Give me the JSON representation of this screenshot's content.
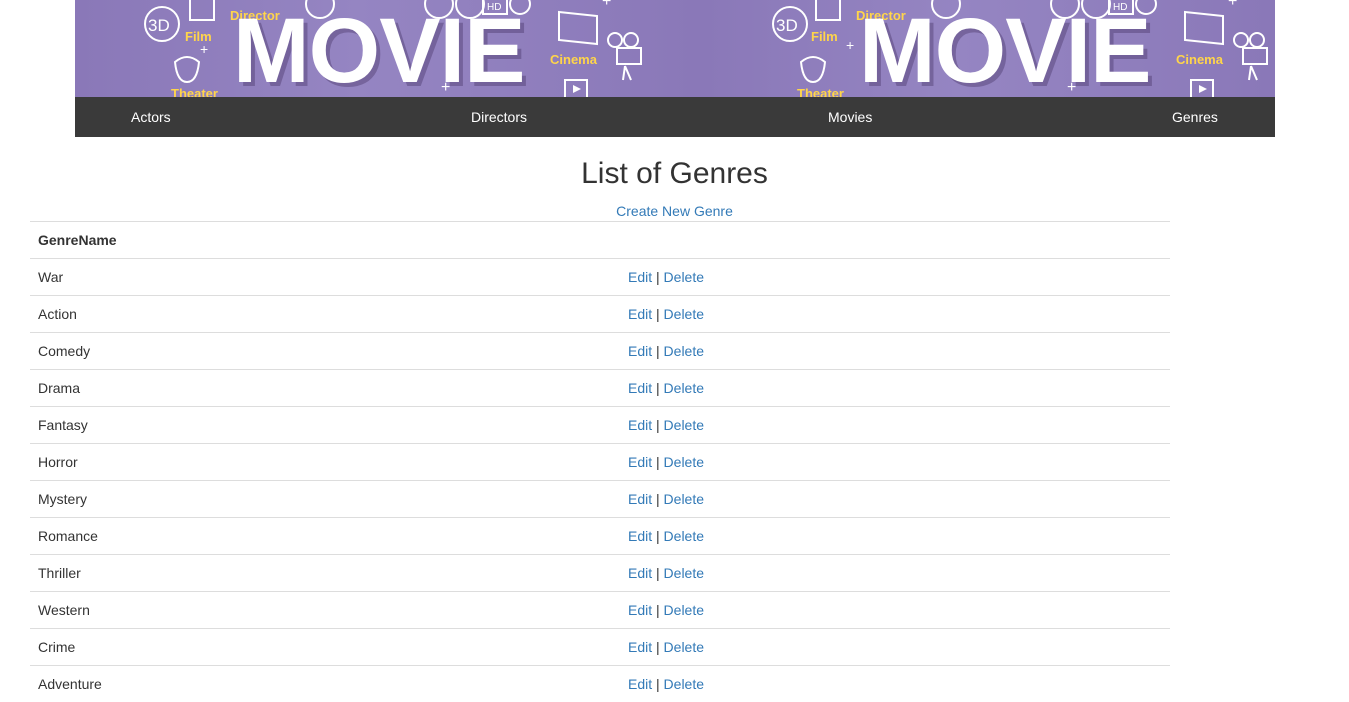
{
  "banner": {
    "word": "MOVIE",
    "labels": [
      "3D",
      "Film",
      "Director",
      "Theater",
      "Cinema",
      "HD"
    ]
  },
  "nav": {
    "items": [
      "Actors",
      "Directors",
      "Movies",
      "Genres"
    ]
  },
  "page": {
    "title": "List of Genres",
    "create_link": "Create New Genre"
  },
  "table": {
    "header": "GenreName",
    "edit_label": "Edit",
    "separator": "|",
    "delete_label": "Delete",
    "rows": [
      "War",
      "Action",
      "Comedy",
      "Drama",
      "Fantasy",
      "Horror",
      "Mystery",
      "Romance",
      "Thriller",
      "Western",
      "Crime",
      "Adventure"
    ]
  },
  "colors": {
    "banner": "#8a78b8",
    "nav_bg": "#3a3a3a",
    "link": "#337ab7"
  }
}
